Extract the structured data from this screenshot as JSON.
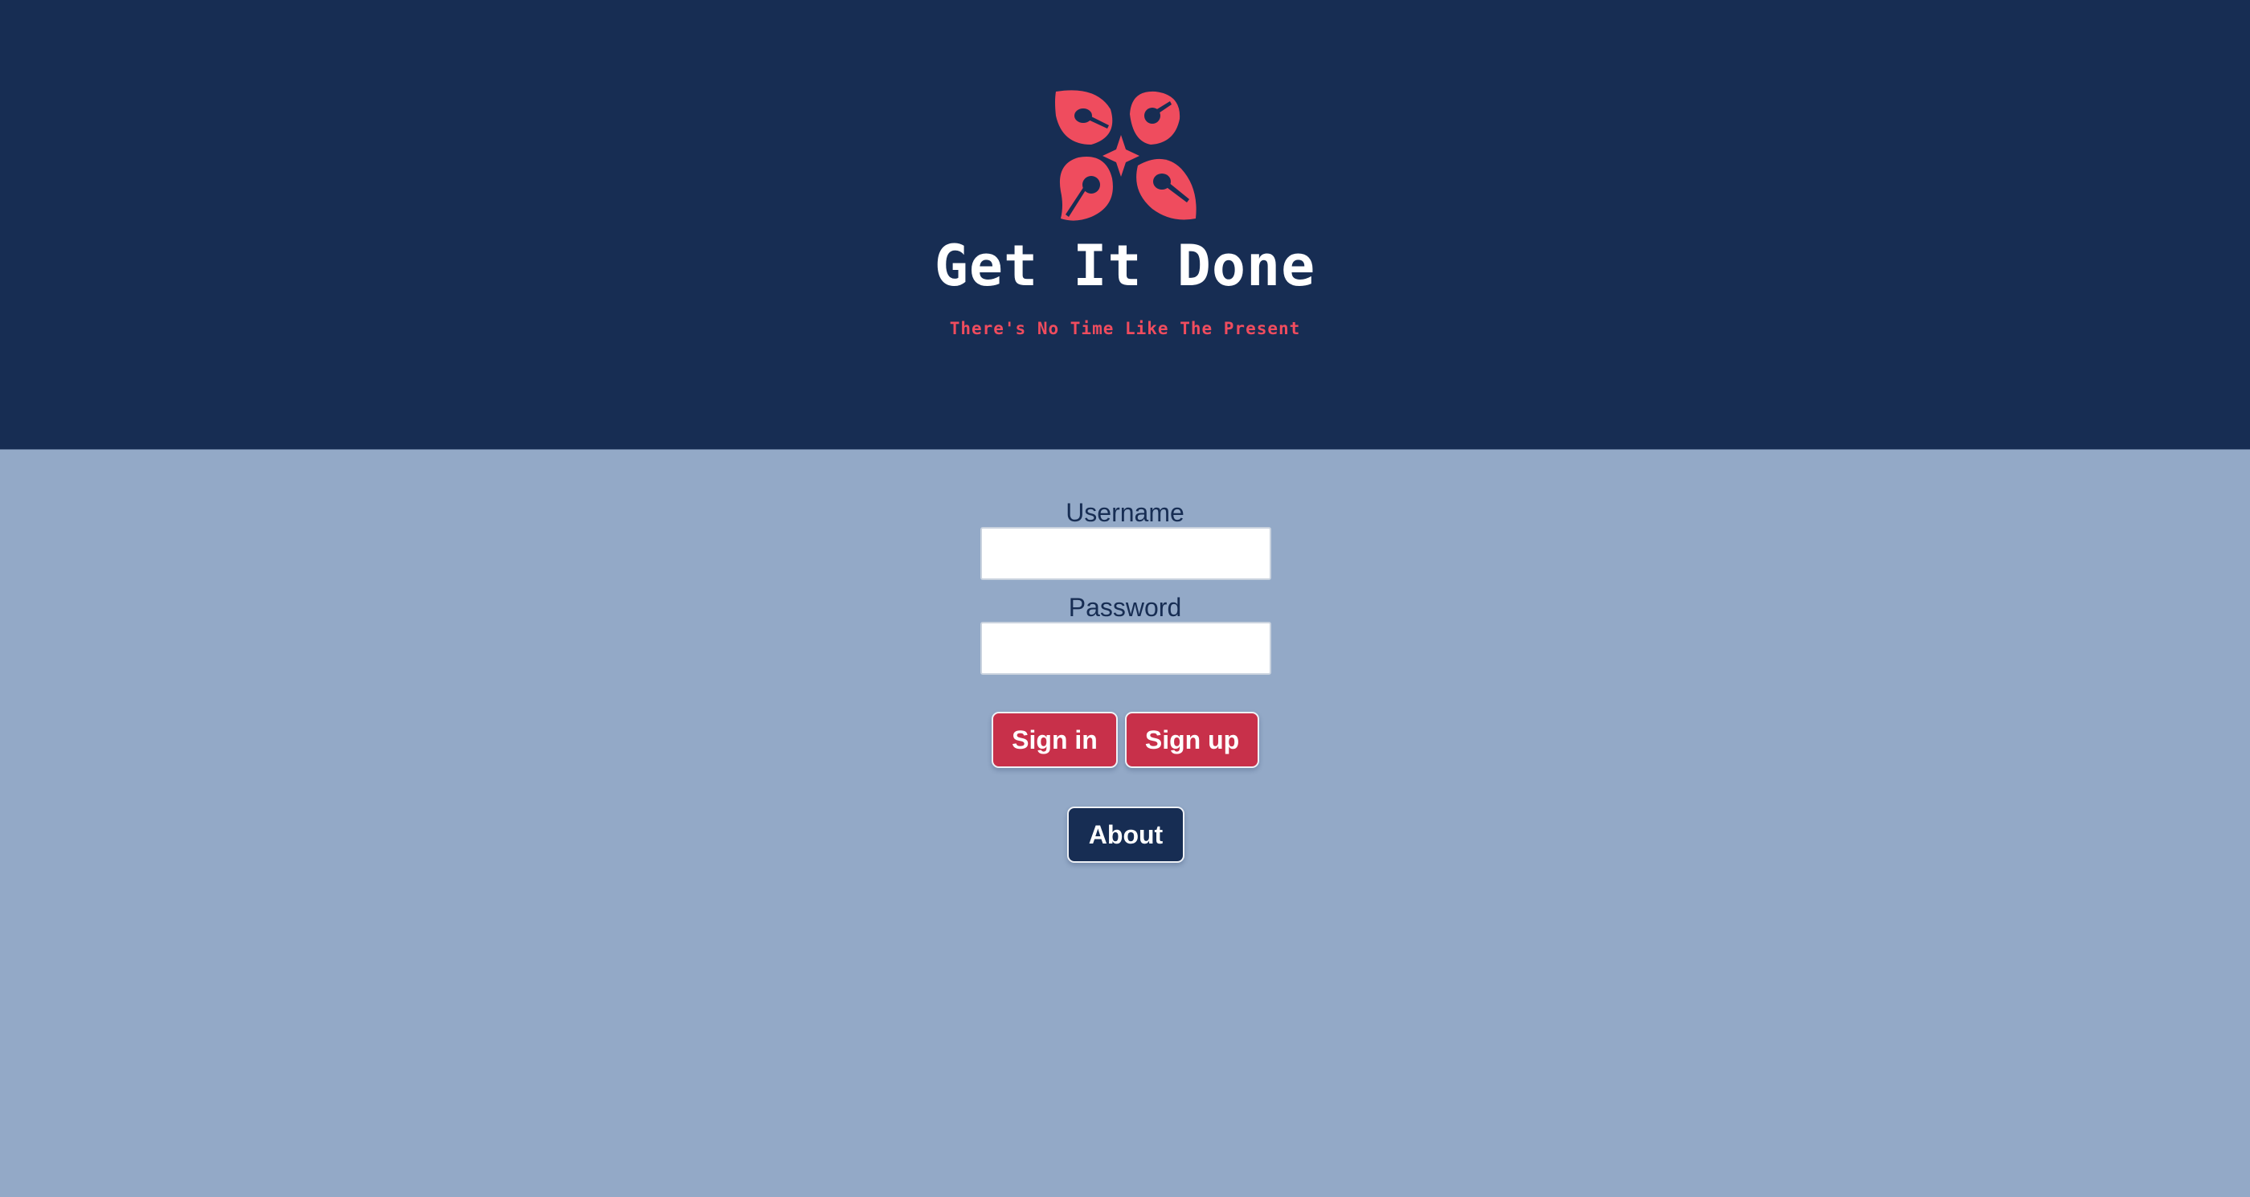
{
  "header": {
    "logo": {
      "icon": "four-petal-clock-logo-icon",
      "color": "#ef4c5e"
    },
    "title": "Get It Done",
    "tagline": "There's No Time Like The Present"
  },
  "login_form": {
    "username_label": "Username",
    "username_value": "",
    "password_label": "Password",
    "password_value": "",
    "sign_in_label": "Sign in",
    "sign_up_label": "Sign up"
  },
  "about_label": "About",
  "colors": {
    "header_background": "#172d53",
    "page_background": "#93a9c7",
    "accent": "#ef4c5e",
    "primary_button": "#c8304a",
    "secondary_button": "#172d53"
  }
}
